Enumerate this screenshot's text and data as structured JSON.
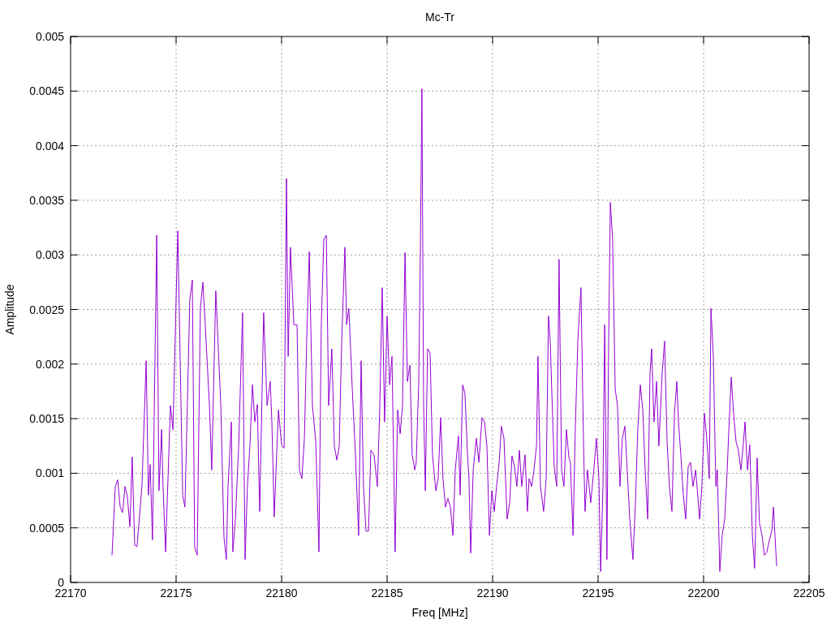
{
  "chart_data": {
    "type": "line",
    "title": "Mc-Tr",
    "xlabel": "Freq [MHz]",
    "ylabel": "Amplitude",
    "x": [
      22171.96,
      22172.12,
      22172.23,
      22172.35,
      22172.46,
      22172.58,
      22172.69,
      22172.81,
      22172.92,
      22173.04,
      22173.15,
      22173.38,
      22173.58,
      22173.69,
      22173.77,
      22173.88,
      22174.08,
      22174.19,
      22174.31,
      22174.38,
      22174.5,
      22174.73,
      22174.85,
      22175.08,
      22175.31,
      22175.42,
      22175.65,
      22175.77,
      22175.88,
      22176.0,
      22176.15,
      22176.27,
      22176.38,
      22176.58,
      22176.69,
      22176.88,
      22177.12,
      22177.27,
      22177.38,
      22177.46,
      22177.62,
      22177.69,
      22177.81,
      22177.96,
      22178.15,
      22178.27,
      22178.38,
      22178.5,
      22178.62,
      22178.73,
      22178.85,
      22178.96,
      22179.15,
      22179.31,
      22179.46,
      22179.54,
      22179.65,
      22179.85,
      22180.0,
      22180.12,
      22180.23,
      22180.31,
      22180.42,
      22180.58,
      22180.73,
      22180.85,
      22180.96,
      22181.08,
      22181.19,
      22181.31,
      22181.46,
      22181.62,
      22181.77,
      22181.88,
      22182.0,
      22182.12,
      22182.23,
      22182.38,
      22182.5,
      22182.62,
      22182.73,
      22182.85,
      22183.0,
      22183.08,
      22183.19,
      22183.35,
      22183.5,
      22183.65,
      22183.77,
      22183.88,
      22184.0,
      22184.12,
      22184.23,
      22184.38,
      22184.54,
      22184.65,
      22184.77,
      22184.88,
      22185.0,
      22185.12,
      22185.23,
      22185.38,
      22185.5,
      22185.62,
      22185.73,
      22185.85,
      22185.96,
      22186.08,
      22186.19,
      22186.31,
      22186.38,
      22186.5,
      22186.58,
      22186.65,
      22186.73,
      22186.81,
      22186.92,
      22187.04,
      22187.15,
      22187.31,
      22187.42,
      22187.54,
      22187.65,
      22187.77,
      22187.88,
      22188.0,
      22188.12,
      22188.23,
      22188.38,
      22188.46,
      22188.58,
      22188.69,
      22188.81,
      22188.88,
      22188.96,
      22189.08,
      22189.23,
      22189.35,
      22189.5,
      22189.62,
      22189.73,
      22189.85,
      22189.96,
      22190.08,
      22190.19,
      22190.31,
      22190.42,
      22190.54,
      22190.69,
      22190.81,
      22190.92,
      22191.04,
      22191.15,
      22191.27,
      22191.38,
      22191.54,
      22191.65,
      22191.73,
      22191.85,
      22191.96,
      22192.08,
      22192.15,
      22192.27,
      22192.42,
      22192.54,
      22192.65,
      22192.73,
      22192.92,
      22193.04,
      22193.15,
      22193.27,
      22193.38,
      22193.5,
      22193.62,
      22193.69,
      22193.81,
      22193.92,
      22194.04,
      22194.19,
      22194.31,
      22194.38,
      22194.5,
      22194.65,
      22194.81,
      22194.92,
      22195.04,
      22195.12,
      22195.23,
      22195.31,
      22195.42,
      22195.5,
      22195.58,
      22195.69,
      22195.81,
      22195.92,
      22196.04,
      22196.15,
      22196.27,
      22196.38,
      22196.5,
      22196.65,
      22196.77,
      22196.88,
      22197.0,
      22197.12,
      22197.23,
      22197.35,
      22197.46,
      22197.54,
      22197.65,
      22197.77,
      22197.88,
      22198.04,
      22198.15,
      22198.27,
      22198.38,
      22198.5,
      22198.62,
      22198.73,
      22198.81,
      22198.92,
      22199.04,
      22199.15,
      22199.27,
      22199.38,
      22199.5,
      22199.62,
      22199.69,
      22199.81,
      22199.92,
      22200.04,
      22200.15,
      22200.27,
      22200.35,
      22200.46,
      22200.58,
      22200.65,
      22200.77,
      22200.88,
      22201.0,
      22201.12,
      22201.19,
      22201.31,
      22201.42,
      22201.54,
      22201.65,
      22201.77,
      22201.88,
      22201.96,
      22202.08,
      22202.19,
      22202.31,
      22202.42,
      22202.54,
      22202.65,
      22202.77,
      22202.88,
      22203.0,
      22203.12,
      22203.23,
      22203.31,
      22203.46
    ],
    "series": [
      {
        "color": "#9400d3",
        "values": [
          0.00025,
          0.00088,
          0.00094,
          0.00069,
          0.00064,
          0.00088,
          0.00079,
          0.00051,
          0.00115,
          0.00034,
          0.00033,
          0.00088,
          0.00203,
          0.0008,
          0.00108,
          0.00039,
          0.00318,
          0.00084,
          0.0014,
          0.00088,
          0.00028,
          0.00162,
          0.0014,
          0.00322,
          0.0008,
          0.00069,
          0.00259,
          0.00277,
          0.00032,
          0.00025,
          0.00251,
          0.00275,
          0.00236,
          0.00162,
          0.00103,
          0.00267,
          0.00162,
          0.00041,
          0.00021,
          0.00088,
          0.00147,
          0.00028,
          0.00058,
          0.00123,
          0.00247,
          0.00021,
          0.00088,
          0.00126,
          0.00181,
          0.00147,
          0.00163,
          0.00065,
          0.00247,
          0.00162,
          0.00184,
          0.00147,
          0.0006,
          0.00158,
          0.00126,
          0.00123,
          0.0037,
          0.00207,
          0.00307,
          0.00236,
          0.00236,
          0.00103,
          0.00095,
          0.00132,
          0.00221,
          0.00303,
          0.00162,
          0.00129,
          0.00028,
          0.00236,
          0.00314,
          0.00318,
          0.00162,
          0.00214,
          0.00125,
          0.00112,
          0.00125,
          0.00221,
          0.00307,
          0.00236,
          0.00251,
          0.00177,
          0.00117,
          0.00043,
          0.00203,
          0.00088,
          0.00047,
          0.00047,
          0.00121,
          0.00117,
          0.00088,
          0.00158,
          0.0027,
          0.00147,
          0.00244,
          0.00181,
          0.00207,
          0.00028,
          0.00158,
          0.00136,
          0.00162,
          0.00302,
          0.00184,
          0.00199,
          0.00117,
          0.00103,
          0.0011,
          0.00184,
          0.00311,
          0.00452,
          0.00162,
          0.00084,
          0.00214,
          0.0021,
          0.00117,
          0.00084,
          0.00095,
          0.00151,
          0.00095,
          0.00069,
          0.00077,
          0.00069,
          0.00043,
          0.00103,
          0.00134,
          0.0008,
          0.00181,
          0.00173,
          0.00117,
          0.00095,
          0.00027,
          0.00103,
          0.00132,
          0.0011,
          0.00151,
          0.00147,
          0.00125,
          0.00043,
          0.00084,
          0.00065,
          0.00088,
          0.0011,
          0.00143,
          0.00132,
          0.00058,
          0.00073,
          0.00116,
          0.00106,
          0.00088,
          0.00121,
          0.00088,
          0.00117,
          0.00065,
          0.00095,
          0.00088,
          0.00103,
          0.00125,
          0.00207,
          0.00088,
          0.00065,
          0.00095,
          0.00244,
          0.00221,
          0.00106,
          0.00088,
          0.00296,
          0.00103,
          0.00088,
          0.0014,
          0.00114,
          0.0011,
          0.00043,
          0.0014,
          0.00221,
          0.0027,
          0.00125,
          0.00065,
          0.00103,
          0.00073,
          0.00106,
          0.00132,
          0.00095,
          0.0001,
          0.00088,
          0.00236,
          0.00021,
          0.00221,
          0.00348,
          0.00314,
          0.00177,
          0.00162,
          0.00088,
          0.00132,
          0.00143,
          0.00103,
          0.00058,
          0.00021,
          0.00073,
          0.0014,
          0.00181,
          0.00158,
          0.00103,
          0.00058,
          0.00192,
          0.00214,
          0.00147,
          0.00184,
          0.00125,
          0.00192,
          0.00221,
          0.00129,
          0.00088,
          0.00065,
          0.00155,
          0.00184,
          0.00147,
          0.00117,
          0.0008,
          0.00058,
          0.00106,
          0.0011,
          0.00088,
          0.00103,
          0.00088,
          0.00058,
          0.00088,
          0.00155,
          0.00132,
          0.00095,
          0.00251,
          0.00207,
          0.00088,
          0.00103,
          0.0001,
          0.00043,
          0.00058,
          0.00103,
          0.00136,
          0.00188,
          0.00155,
          0.00129,
          0.00121,
          0.00103,
          0.00126,
          0.00147,
          0.00103,
          0.00126,
          0.00043,
          0.00013,
          0.00114,
          0.00054,
          0.00043,
          0.00025,
          0.00028,
          0.00039,
          0.00047,
          0.00069,
          0.00015
        ]
      }
    ],
    "grid": true,
    "xlim": [
      22170,
      22205
    ],
    "ylim": [
      0,
      0.005
    ],
    "xticks": [
      22170,
      22175,
      22180,
      22185,
      22190,
      22195,
      22200,
      22205
    ],
    "yticks": [
      0,
      0.0005,
      0.001,
      0.0015,
      0.002,
      0.0025,
      0.003,
      0.0035,
      0.004,
      0.0045,
      0.005
    ]
  }
}
